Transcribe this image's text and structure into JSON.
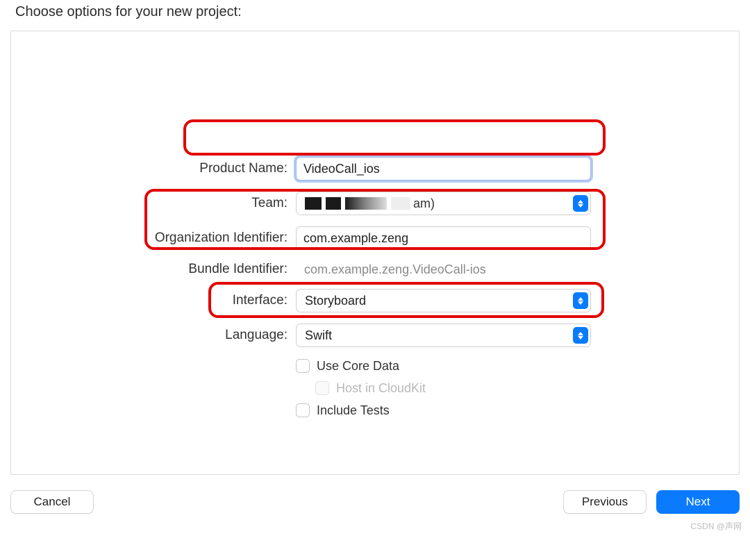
{
  "header": {
    "title": "Choose options for your new project:"
  },
  "form": {
    "product_name": {
      "label": "Product Name:",
      "value": "VideoCall_ios"
    },
    "team": {
      "label": "Team:",
      "value_suffix": "am)"
    },
    "org_id": {
      "label": "Organization Identifier:",
      "value": "com.example.zeng"
    },
    "bundle_id": {
      "label": "Bundle Identifier:",
      "value": "com.example.zeng.VideoCall-ios"
    },
    "interface": {
      "label": "Interface:",
      "value": "Storyboard"
    },
    "language": {
      "label": "Language:",
      "value": "Swift"
    },
    "use_core_data": {
      "label": "Use Core Data",
      "checked": false
    },
    "host_cloudkit": {
      "label": "Host in CloudKit",
      "checked": false,
      "enabled": false
    },
    "include_tests": {
      "label": "Include Tests",
      "checked": false
    }
  },
  "buttons": {
    "cancel": "Cancel",
    "previous": "Previous",
    "next": "Next"
  },
  "watermark": "CSDN @声网"
}
